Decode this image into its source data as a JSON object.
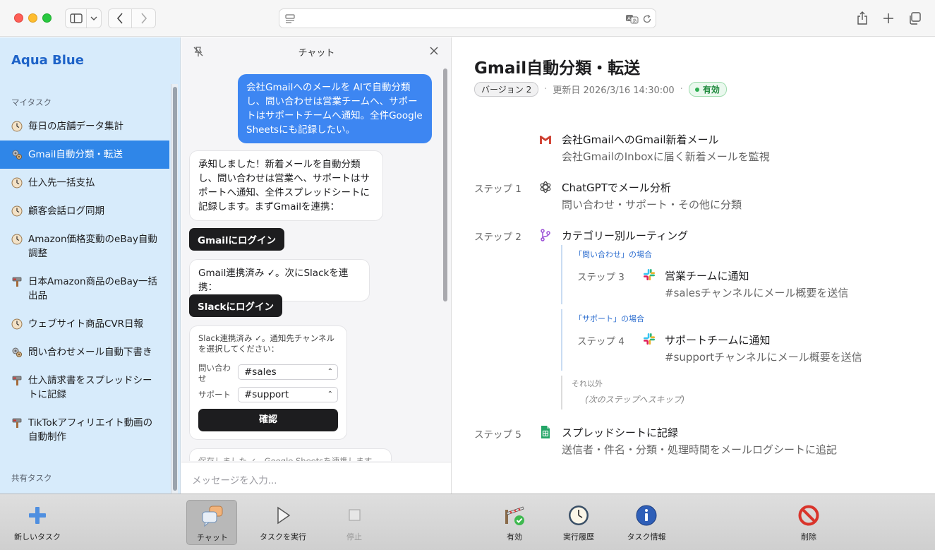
{
  "sidebar": {
    "brand": "Aqua Blue",
    "my_tasks_label": "マイタスク",
    "shared_tasks_label": "共有タスク",
    "items": [
      {
        "label": "毎日の店舗データ集計",
        "icon": "clock-icon"
      },
      {
        "label": "Gmail自動分類・転送",
        "icon": "gears-icon"
      },
      {
        "label": "仕入先一括支払",
        "icon": "clock-icon"
      },
      {
        "label": "顧客会話ログ同期",
        "icon": "clock-icon"
      },
      {
        "label": "Amazon価格変動のeBay自動調整",
        "icon": "clock-icon"
      },
      {
        "label": "日本Amazon商品のeBay一括出品",
        "icon": "hammer-icon"
      },
      {
        "label": "ウェブサイト商品CVR日報",
        "icon": "clock-icon"
      },
      {
        "label": "問い合わせメール自動下書き",
        "icon": "gears-icon"
      },
      {
        "label": "仕入請求書をスプレッドシートに記録",
        "icon": "hammer-icon"
      },
      {
        "label": "TikTokアフィリエイト動画の自動制作",
        "icon": "hammer-icon"
      }
    ]
  },
  "chat": {
    "title": "チャット",
    "user_message": "会社Gmailへのメールを AIで自動分類し、問い合わせは営業チームへ、サポートはサポートチームへ通知。全件Google Sheetsにも記録したい。",
    "bot_message_1": "承知しました！新着メールを自動分類し、問い合わせは営業へ、サポートはサポートへ通知、全件スプレッドシートに記録します。まずGmailを連携：",
    "gmail_login": "Gmailにログイン",
    "bot_message_2": "Gmail連携済み ✓。次にSlackを連携：",
    "slack_login": "Slackにログイン",
    "card_text": "Slack連携済み ✓。通知先チャンネルを選択してください：",
    "inquiry_label": "問い合わせ",
    "inquiry_value": "#sales",
    "support_label": "サポート",
    "support_value": "#support",
    "confirm": "確認",
    "bot_message_3": "保存しました ✓。Google Sheetsを連携します",
    "input_placeholder": "メッセージを入力..."
  },
  "workflow": {
    "title": "Gmail自動分類・転送",
    "version": "バージョン 2",
    "updated": "更新日 2026/3/16 14:30:00",
    "status": "有効",
    "trigger": {
      "title": "会社GmailへのGmail新着メール",
      "desc": "会社GmailのInboxに届く新着メールを監視",
      "icon": "gmail-icon"
    },
    "steps": [
      {
        "label": "ステップ 1",
        "title": "ChatGPTでメール分析",
        "desc": "問い合わせ・サポート・その他に分類",
        "icon": "chatgpt-icon"
      },
      {
        "label": "ステップ 2",
        "title": "カテゴリー別ルーティング",
        "desc": "",
        "icon": "branch-icon"
      },
      {
        "label": "ステップ 5",
        "title": "スプレッドシートに記録",
        "desc": "送信者・件名・分類・処理時間をメールログシートに追記",
        "icon": "sheets-icon"
      }
    ],
    "branches": [
      {
        "condition": "「問い合わせ」の場合",
        "label": "ステップ 3",
        "title": "営業チームに通知",
        "desc": "#salesチャンネルにメール概要を送信",
        "icon": "slack-icon"
      },
      {
        "condition": "「サポート」の場合",
        "label": "ステップ 4",
        "title": "サポートチームに通知",
        "desc": "#supportチャンネルにメール概要を送信",
        "icon": "slack-icon"
      }
    ],
    "otherwise": {
      "condition": "それ以外",
      "note": "(次のステップへスキップ)"
    }
  },
  "toolbar": {
    "new_task": "新しいタスク",
    "chat": "チャット",
    "run": "タスクを実行",
    "stop": "停止",
    "enable": "有効",
    "history": "実行履歴",
    "info": "タスク情報",
    "delete": "削除"
  },
  "colors": {
    "accent": "#2f86e8",
    "sidebar_bg": "#d7ebfb",
    "user_bubble": "#3d86f2",
    "active_badge": "#1f8a3d"
  }
}
